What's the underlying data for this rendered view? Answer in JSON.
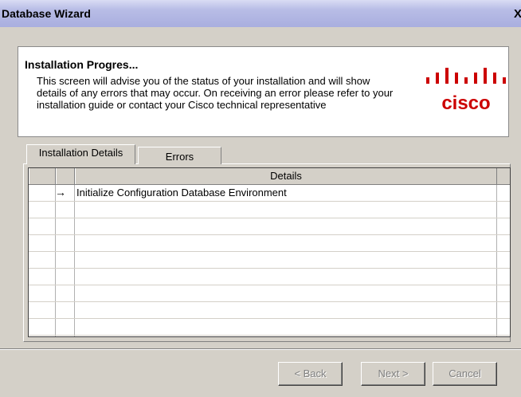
{
  "window": {
    "title": "Database Wizard",
    "close_label": "X"
  },
  "header": {
    "title": "Installation Progres...",
    "description": "This screen will advise you of the status of your installation and will show details of any errors that may occur. On receiving an error please refer to your installation guide or contact your Cisco technical representative",
    "logo_text": "cisco",
    "logo_color": "#cc0000"
  },
  "tabs": [
    {
      "label": "Installation Details",
      "selected": true
    },
    {
      "label": "Errors",
      "selected": false
    }
  ],
  "grid": {
    "columns": [
      "",
      "",
      "Details"
    ],
    "rows": [
      {
        "status_icon": "arrow-right-icon",
        "arrow": "→",
        "details": "Initialize Configuration Database Environment"
      }
    ]
  },
  "buttons": {
    "back": "< Back",
    "next": "Next >",
    "cancel": "Cancel"
  },
  "icons": {
    "close": "close-icon",
    "logo": "cisco-logo-icon"
  }
}
